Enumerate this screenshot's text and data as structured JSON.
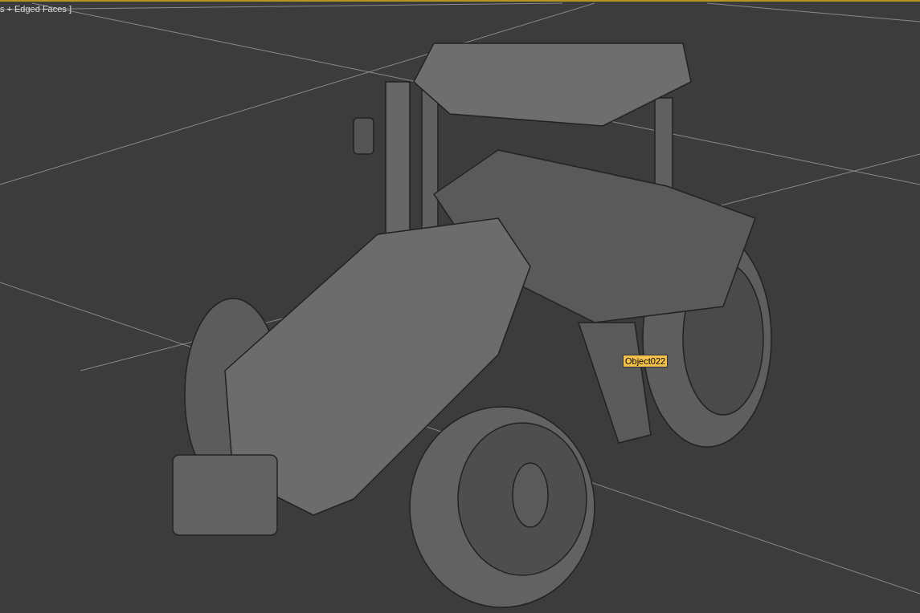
{
  "viewport": {
    "label": "s + Edged Faces ]",
    "active": true
  },
  "tooltip": {
    "text": "Object022"
  }
}
